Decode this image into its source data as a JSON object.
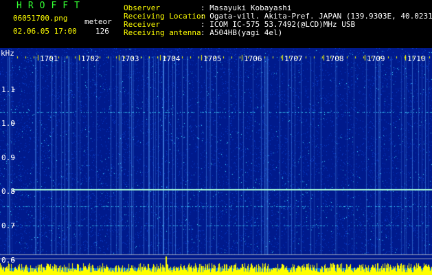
{
  "header": {
    "program_title": "HROFFT",
    "filename": "06051700.png",
    "datetime": "02.06.05 17:00",
    "count_label": "meteor",
    "count_value": "126",
    "fields": [
      {
        "label": "Observer",
        "value": ": Masayuki Kobayashi"
      },
      {
        "label": "Receiving Location",
        "value": ": Ogata-vill. Akita-Pref. JAPAN (139.9303E, 40.0231N)"
      },
      {
        "label": "Receiver",
        "value": ": ICOM IC-575 53.7492(@LCD)MHz USB"
      },
      {
        "label": "Receiving antenna",
        "value": ": A504HB(yagi 4el)"
      }
    ]
  },
  "spectrogram": {
    "y_unit": "kHz",
    "y_ticks": [
      "1.1",
      "1.0",
      "0.9",
      "0.8",
      "0.7",
      "0.6"
    ],
    "time_ticks": [
      "1701",
      "1702",
      "1703",
      "1704",
      "1705",
      "1706",
      "1707",
      "1708",
      "1709",
      "1710"
    ],
    "colors": {
      "background": "#001a8c",
      "noise": "#0a3cc8",
      "signal": "#3cdcff",
      "carrier": "#a8ffd8",
      "tick": "#ffff00",
      "bar": "#ffff00"
    }
  }
}
